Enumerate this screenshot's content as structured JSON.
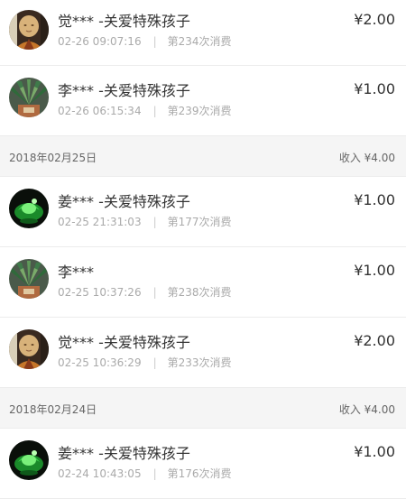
{
  "items": [
    {
      "type": "entry",
      "avatar": "monk-avatar",
      "name": "觉*** -关爱特殊孩子",
      "time": "02-26 09:07:16",
      "count": "第234次消费",
      "amount": "¥2.00"
    },
    {
      "type": "entry",
      "avatar": "plant-avatar",
      "name": "李*** -关爱特殊孩子",
      "time": "02-26 06:15:34",
      "count": "第239次消费",
      "amount": "¥1.00"
    },
    {
      "type": "header",
      "date": "2018年02月25日",
      "income": "收入 ¥4.00"
    },
    {
      "type": "entry",
      "avatar": "green-avatar",
      "name": "姜*** -关爱特殊孩子",
      "time": "02-25 21:31:03",
      "count": "第177次消费",
      "amount": "¥1.00"
    },
    {
      "type": "entry",
      "avatar": "plant-avatar",
      "name": "李***",
      "time": "02-25 10:37:26",
      "count": "第238次消费",
      "amount": "¥1.00"
    },
    {
      "type": "entry",
      "avatar": "monk-avatar",
      "name": "觉*** -关爱特殊孩子",
      "time": "02-25 10:36:29",
      "count": "第233次消费",
      "amount": "¥2.00"
    },
    {
      "type": "header",
      "date": "2018年02月24日",
      "income": "收入 ¥4.00"
    },
    {
      "type": "entry",
      "avatar": "green-avatar",
      "name": "姜*** -关爱特殊孩子",
      "time": "02-24 10:43:05",
      "count": "第176次消费",
      "amount": "¥1.00"
    }
  ],
  "separator": "|"
}
